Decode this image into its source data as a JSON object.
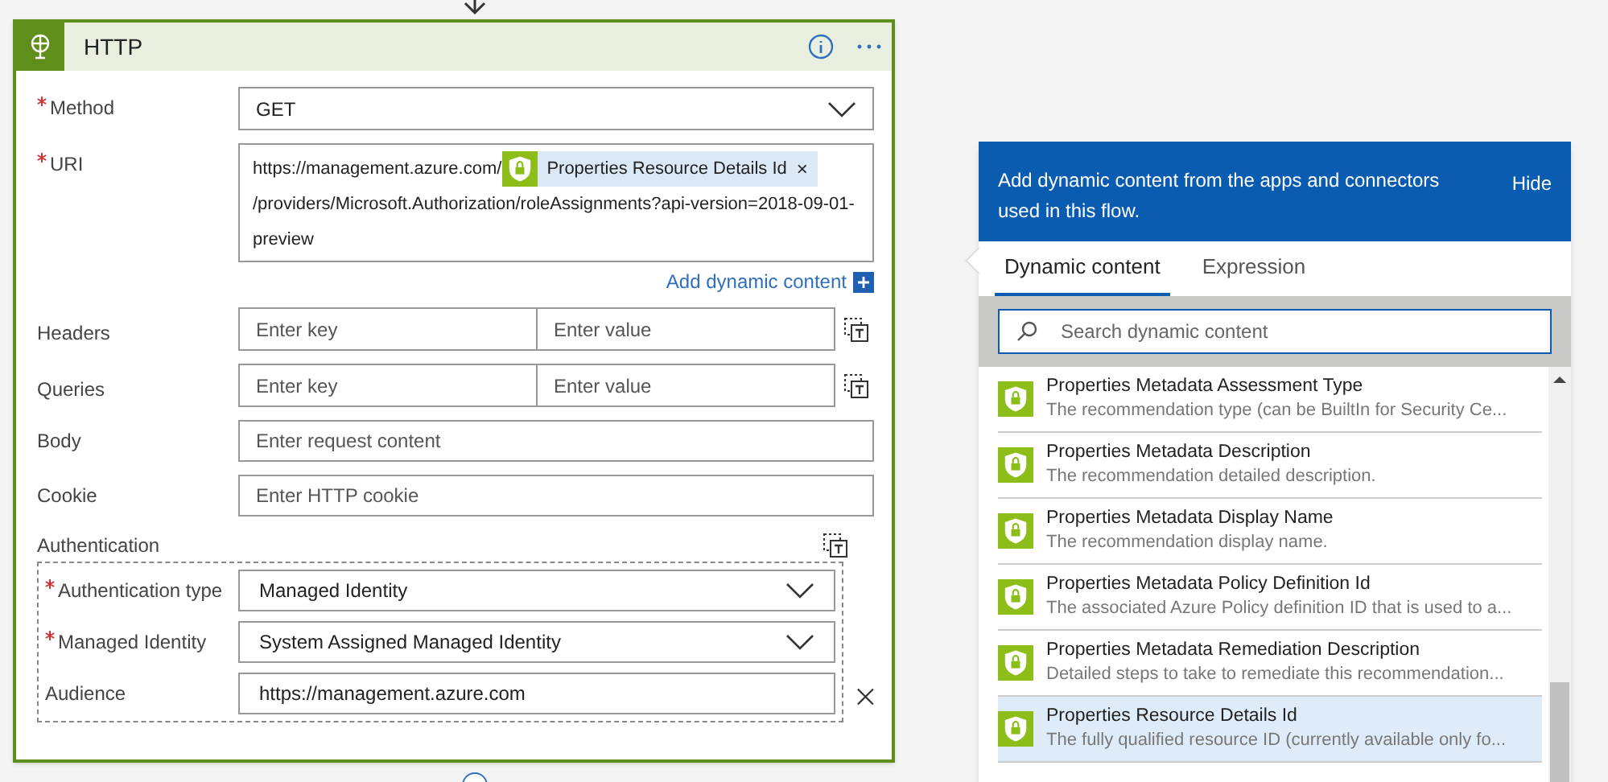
{
  "card": {
    "title": "HTTP",
    "method": {
      "label": "Method",
      "required": true,
      "value": "GET"
    },
    "uri": {
      "label": "URI",
      "required": true,
      "before": "https://management.azure.com/",
      "token": "Properties Resource Details Id",
      "token_remove": "×",
      "after": "/providers/Microsoft.Authorization/roleAssignments?api-version=2018-09-01-preview"
    },
    "add_dynamic": "Add dynamic content",
    "pairs": [
      {
        "label": "Headers",
        "key_placeholder": "Enter key",
        "value_placeholder": "Enter value"
      },
      {
        "label": "Queries",
        "key_placeholder": "Enter key",
        "value_placeholder": "Enter value"
      }
    ],
    "texts": [
      {
        "label": "Body",
        "placeholder": "Enter request content"
      },
      {
        "label": "Cookie",
        "placeholder": "Enter HTTP cookie"
      }
    ],
    "authentication": {
      "label": "Authentication",
      "fields": [
        {
          "kind": "dropdown",
          "label": "Authentication type",
          "required": true,
          "value": "Managed Identity"
        },
        {
          "kind": "dropdown",
          "label": "Managed Identity",
          "required": true,
          "value": "System Assigned Managed Identity"
        },
        {
          "kind": "text",
          "label": "Audience",
          "required": false,
          "value": "https://management.azure.com"
        }
      ]
    }
  },
  "panel": {
    "banner": "Add dynamic content from the apps and connectors used in this flow.",
    "hide": "Hide",
    "tabs": [
      {
        "label": "Dynamic content",
        "selected": true
      },
      {
        "label": "Expression",
        "selected": false
      }
    ],
    "search": {
      "placeholder": "Search dynamic content"
    },
    "items": [
      {
        "title": "Properties Metadata Assessment Type",
        "description": "The recommendation type (can be BuiltIn for Security Ce...",
        "selected": false
      },
      {
        "title": "Properties Metadata Description",
        "description": "The recommendation detailed description.",
        "selected": false
      },
      {
        "title": "Properties Metadata Display Name",
        "description": "The recommendation display name.",
        "selected": false
      },
      {
        "title": "Properties Metadata Policy Definition Id",
        "description": "The associated Azure Policy definition ID that is used to a...",
        "selected": false
      },
      {
        "title": "Properties Metadata Remediation Description",
        "description": "Detailed steps to take to remediate this recommendation...",
        "selected": false
      },
      {
        "title": "Properties Resource Details Id",
        "description": "The fully qualified resource ID (currently available only fo...",
        "selected": true
      }
    ]
  }
}
